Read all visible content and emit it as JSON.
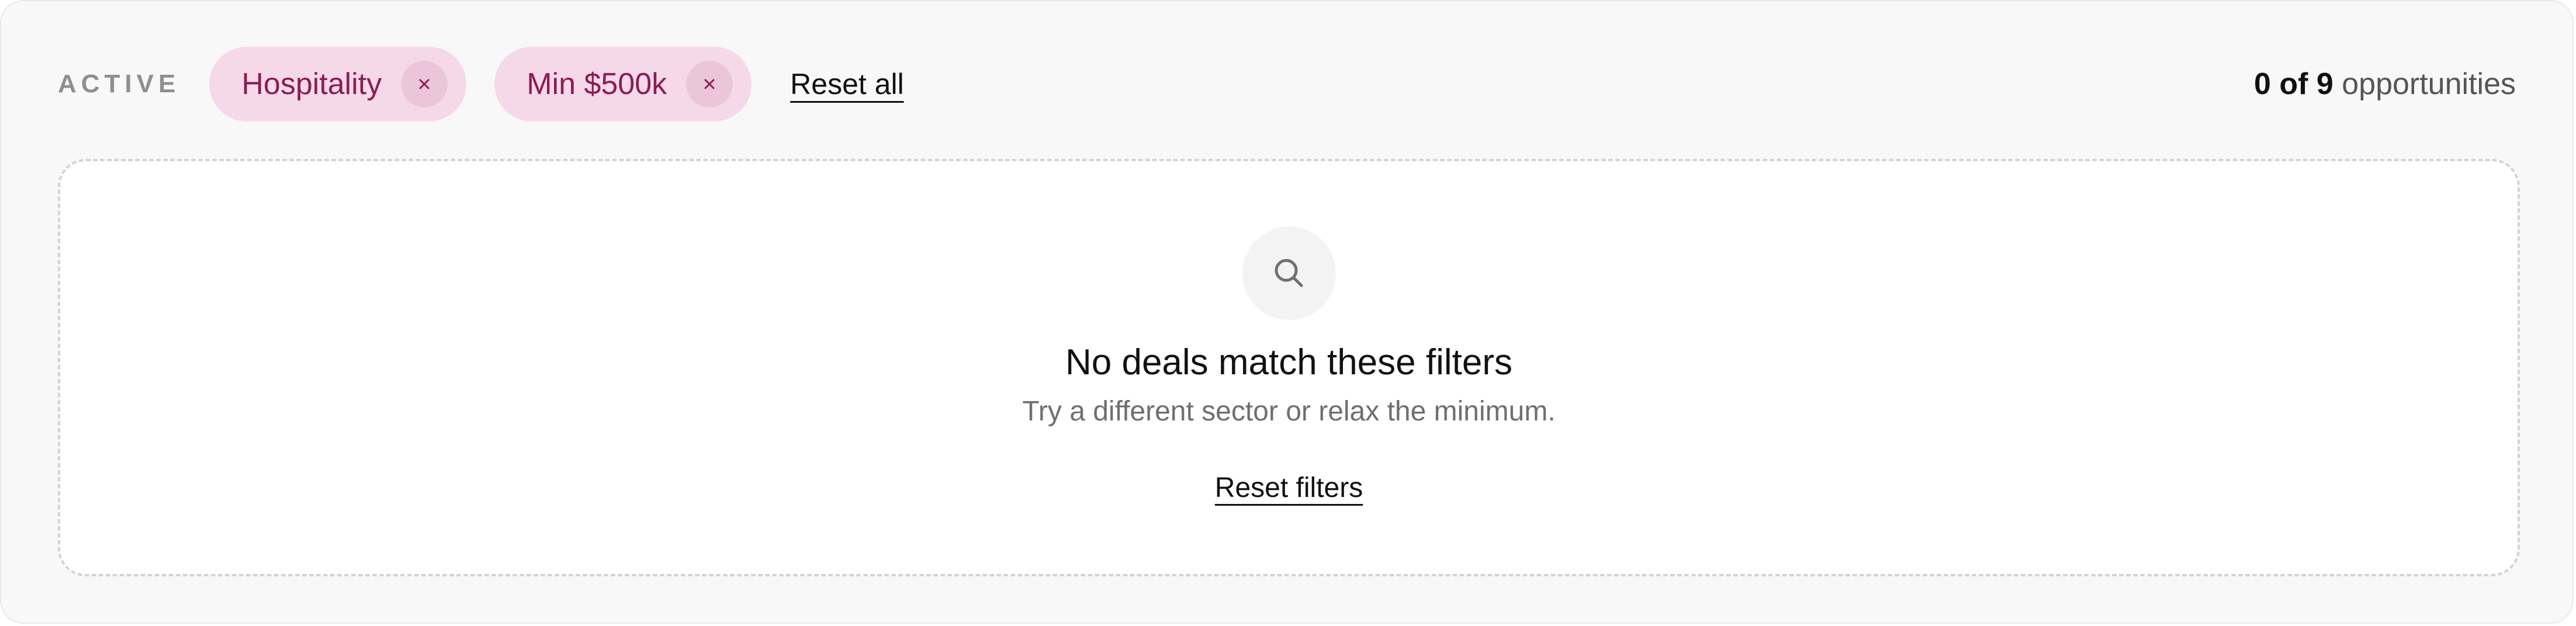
{
  "filters": {
    "active_label": "ACTIVE",
    "chips": [
      {
        "label": "Hospitality",
        "remove_icon": "close-icon"
      },
      {
        "label": "Min $500k",
        "remove_icon": "close-icon"
      }
    ],
    "reset_all_label": "Reset all"
  },
  "results": {
    "shown": "0 of 9",
    "noun": "opportunities"
  },
  "empty_state": {
    "icon": "search-icon",
    "title": "No deals match these filters",
    "subtitle": "Try a different sector or relax the minimum.",
    "action_label": "Reset filters"
  },
  "colors": {
    "chip_background": "#f6d9e9",
    "chip_text": "#8a1c55",
    "panel_background": "#f8f8f8"
  }
}
